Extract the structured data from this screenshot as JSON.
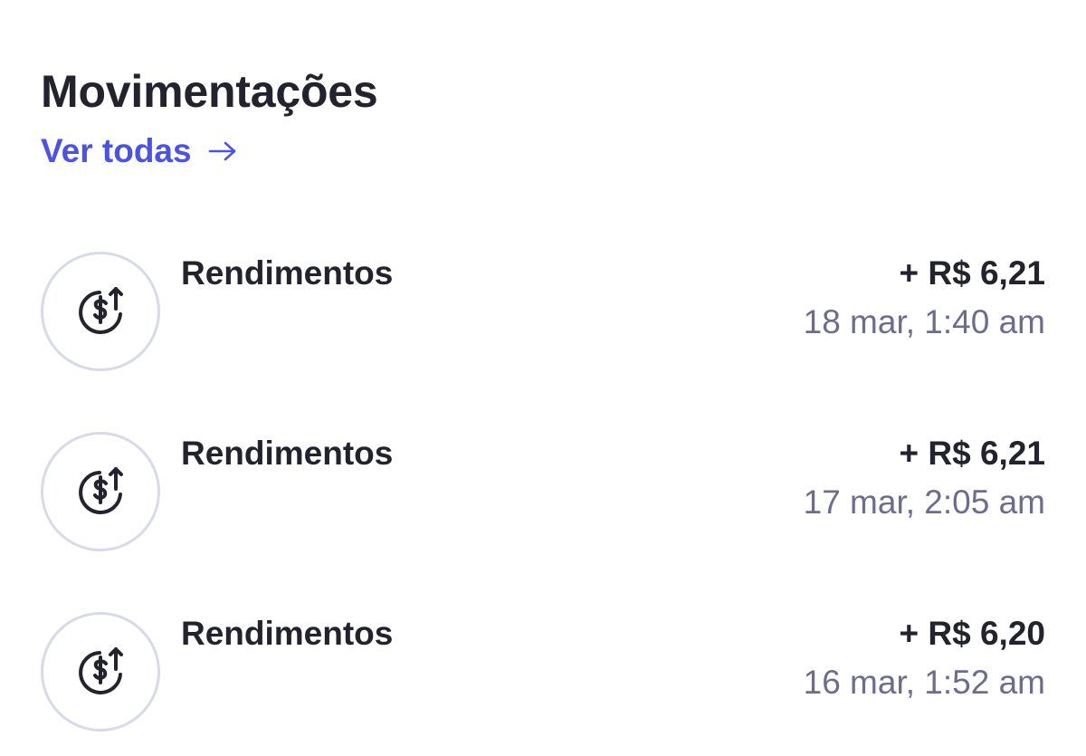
{
  "section": {
    "title": "Movimentações",
    "see_all_label": "Ver todas",
    "see_all_icon": "arrow-right-icon"
  },
  "colors": {
    "accent": "#4a54e1",
    "text": "#23232f",
    "muted": "#6c6d8e",
    "icon_border": "#d8d9eb"
  },
  "transactions": [
    {
      "icon": "dollar-up-icon",
      "label": "Rendimentos",
      "amount": "+ R$ 6,21",
      "date": "18 mar, 1:40 am"
    },
    {
      "icon": "dollar-up-icon",
      "label": "Rendimentos",
      "amount": "+ R$ 6,21",
      "date": "17 mar, 2:05 am"
    },
    {
      "icon": "dollar-up-icon",
      "label": "Rendimentos",
      "amount": "+ R$ 6,20",
      "date": "16 mar, 1:52 am"
    }
  ]
}
